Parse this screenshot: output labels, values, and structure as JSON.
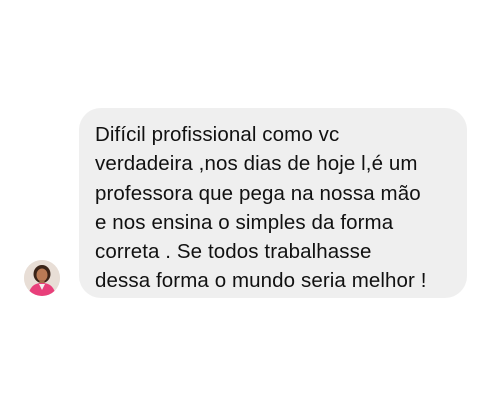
{
  "conversation": {
    "message": {
      "lines": [
        "Difícil profissional como vc",
        "verdadeira ,nos dias de hoje l,é um",
        "professora que pega na nossa mão",
        "e nos ensina o simples da forma",
        "correta . Se todos trabalhasse",
        "dessa forma o mundo seria melhor !"
      ]
    },
    "sender": {
      "avatar_icon": "profile-photo-avatar",
      "accent_color": "#e83f7a"
    }
  },
  "colors": {
    "background": "#ffffff",
    "bubble": "#efefef",
    "text": "#111111"
  }
}
